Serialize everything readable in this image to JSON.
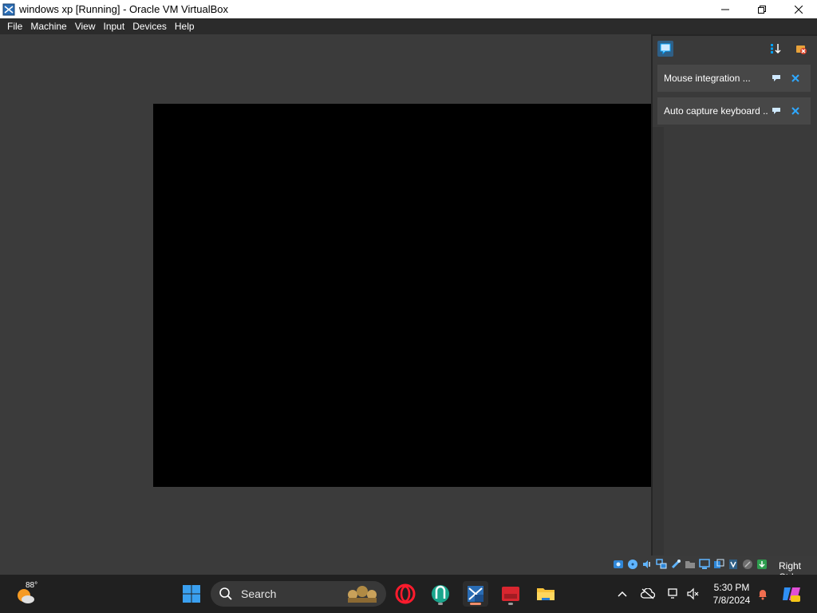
{
  "window": {
    "title": "windows xp [Running] - Oracle VM VirtualBox",
    "controls": [
      "minimize",
      "maximize",
      "close"
    ]
  },
  "menu": {
    "items": [
      "File",
      "Machine",
      "View",
      "Input",
      "Devices",
      "Help"
    ]
  },
  "notifications": {
    "items": [
      {
        "label": "Mouse integration ..."
      },
      {
        "label": "Auto capture keyboard ..."
      }
    ]
  },
  "statusbar": {
    "host_key": "Right Ctrl",
    "icons": [
      "hard-disk-icon",
      "optical-drive-icon",
      "audio-icon",
      "network-icon",
      "usb-icon",
      "shared-folders-icon",
      "display-icon",
      "recording-icon",
      "cpu-icon",
      "mouse-integration-icon",
      "keyboard-capture-icon"
    ]
  },
  "taskbar": {
    "weather_temp": "88°",
    "search_label": "Search",
    "time": "5:30 PM",
    "date": "7/8/2024"
  },
  "colors": {
    "vm_background": "#3b3b3b",
    "vm_screen": "#000000",
    "taskbar": "#202020",
    "accent": "#00a2ff",
    "running_indicator": "#f08d6a"
  }
}
